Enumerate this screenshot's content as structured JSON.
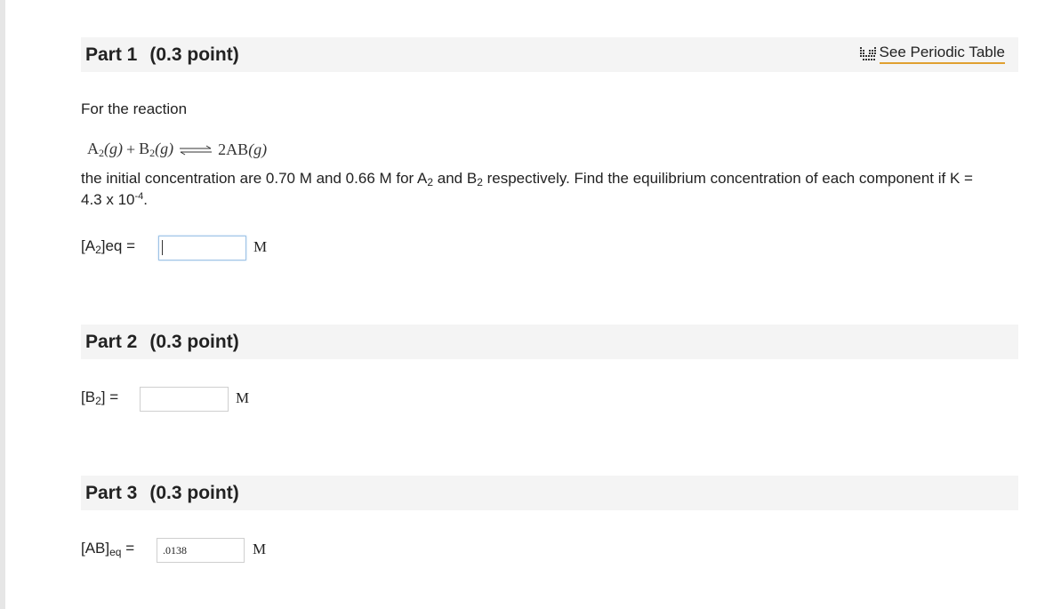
{
  "part1": {
    "label": "Part 1",
    "points": "(0.3 point)",
    "periodic_link": "See Periodic Table",
    "intro": "For the reaction",
    "reaction": {
      "r1_base": "A",
      "r1_sub": "2",
      "r1_phase": "(g)",
      "plus": "+",
      "r2_base": "B",
      "r2_sub": "2",
      "r2_phase": "(g)",
      "product_base": "2AB",
      "product_phase": "(g)"
    },
    "problem_line1": {
      "t1": "the initial concentration are 0.70 M and 0.66 M for A",
      "s1": "2",
      "t2": " and B",
      "s2": "2",
      "t3": " respectively. Find the equilibrium concentration of each component if K ="
    },
    "problem_line2": {
      "base": "4.3 x 10",
      "exp": "-4",
      "end": "."
    },
    "field": {
      "pre": "[A",
      "sub": "2",
      "post": "]eq =",
      "value": "",
      "unit": "M"
    }
  },
  "part2": {
    "label": "Part 2",
    "points": "(0.3 point)",
    "field": {
      "pre": "[B",
      "sub": "2",
      "post": "] =",
      "value": "",
      "unit": "M"
    }
  },
  "part3": {
    "label": "Part 3",
    "points": "(0.3 point)",
    "field": {
      "pre": "[AB]",
      "sub": "eq",
      "post": " =",
      "value": ".0138",
      "unit": "M"
    }
  },
  "colors": {
    "header_bg": "#f4f4f4",
    "link_underline": "#e0a030",
    "focus_border": "#9ec3e6"
  },
  "icons": {
    "periodic": "periodic-table-icon",
    "equilibrium": "equilibrium-arrow-icon"
  }
}
